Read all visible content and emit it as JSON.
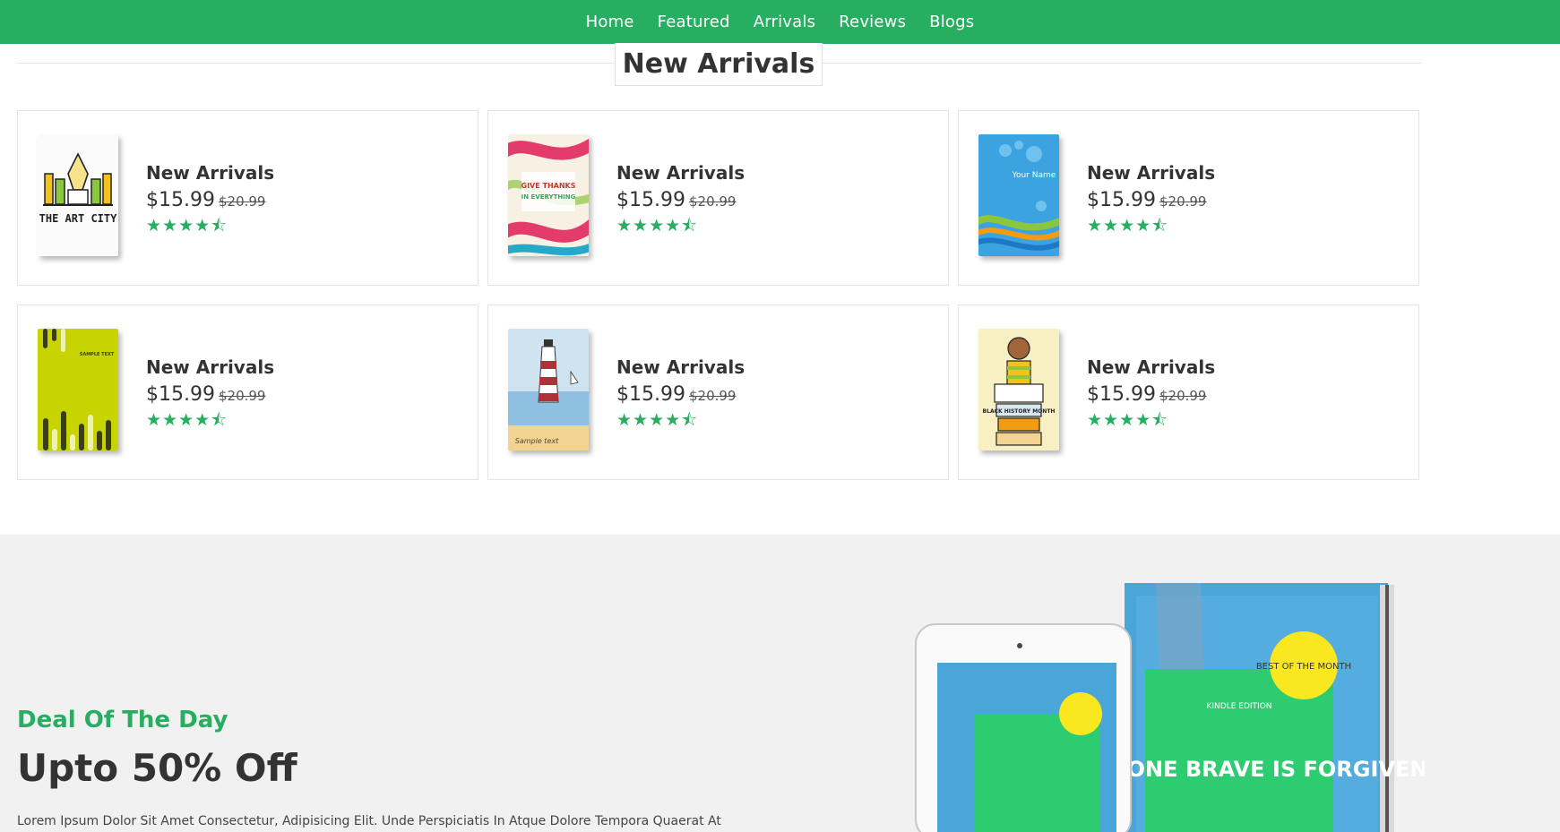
{
  "nav": {
    "items": [
      {
        "label": "Home"
      },
      {
        "label": "Featured"
      },
      {
        "label": "Arrivals"
      },
      {
        "label": "Reviews"
      },
      {
        "label": "Blogs"
      }
    ]
  },
  "arrivals": {
    "heading": "New Arrivals",
    "products": [
      {
        "title": "New Arrivals",
        "price": "$15.99",
        "old_price": "$20.99",
        "rating": 4.5,
        "cover_text": "THE ART CITY"
      },
      {
        "title": "New Arrivals",
        "price": "$15.99",
        "old_price": "$20.99",
        "rating": 4.5,
        "cover_text": "GIVE THANKS IN EVERYTHING"
      },
      {
        "title": "New Arrivals",
        "price": "$15.99",
        "old_price": "$20.99",
        "rating": 4.5,
        "cover_text": "Your Name"
      },
      {
        "title": "New Arrivals",
        "price": "$15.99",
        "old_price": "$20.99",
        "rating": 4.5,
        "cover_text": "SAMPLE TEXT"
      },
      {
        "title": "New Arrivals",
        "price": "$15.99",
        "old_price": "$20.99",
        "rating": 4.5,
        "cover_text": "Sample text"
      },
      {
        "title": "New Arrivals",
        "price": "$15.99",
        "old_price": "$20.99",
        "rating": 4.5,
        "cover_text": "BLACK HISTORY MONTH"
      }
    ]
  },
  "deal": {
    "tag": "Deal Of The Day",
    "title": "Upto 50% Off",
    "text": "Lorem Ipsum Dolor Sit Amet Consectetur, Adipisicing Elit. Unde Perspiciatis In Atque Dolore Tempora Quaerat At",
    "book_badge": "BEST OF THE MONTH",
    "book_edition": "KINDLE EDITION",
    "book_title": "EVERYONE BRAVE IS FORGIVEN"
  },
  "colors": {
    "accent": "#27ae60",
    "text": "#333333",
    "deal_bg": "#f1f1f1"
  }
}
